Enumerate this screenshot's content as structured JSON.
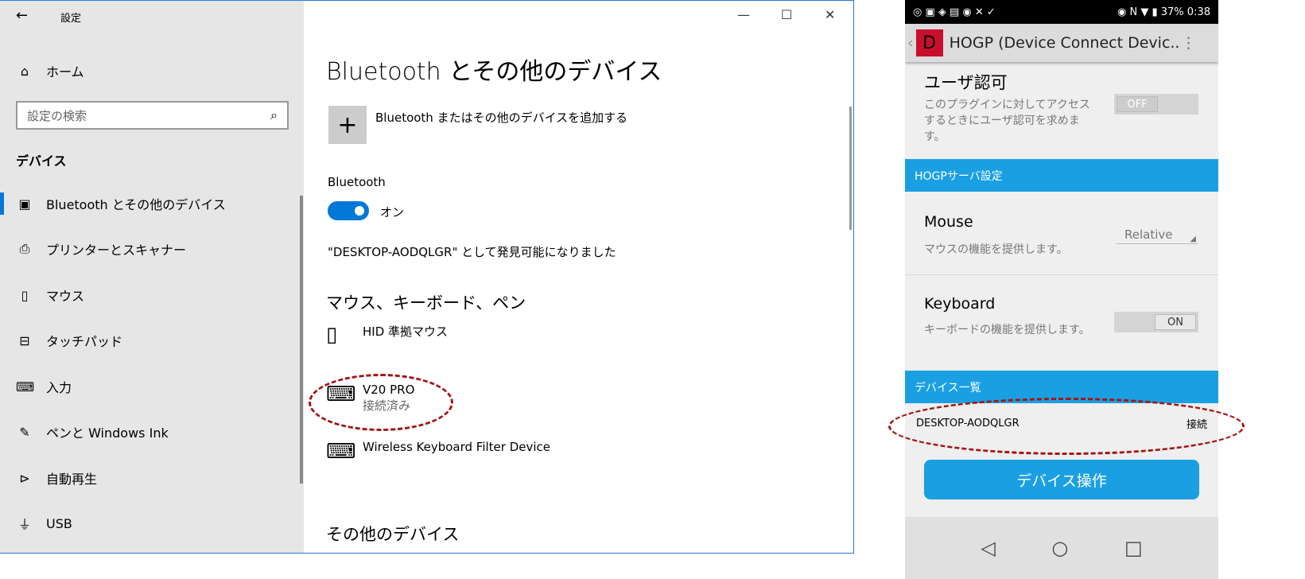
{
  "window": {
    "title": "設定",
    "back_icon": "←",
    "min": "—",
    "max": "☐",
    "close": "✕"
  },
  "sidebar": {
    "home": "ホーム",
    "search_placeholder": "設定の検索",
    "section": "デバイス",
    "items": [
      {
        "label": "Bluetooth とその他のデバイス",
        "icon": "bluetooth-devices"
      },
      {
        "label": "プリンターとスキャナー",
        "icon": "printer"
      },
      {
        "label": "マウス",
        "icon": "mouse"
      },
      {
        "label": "タッチパッド",
        "icon": "touchpad"
      },
      {
        "label": "入力",
        "icon": "keyboard"
      },
      {
        "label": "ペンと Windows Ink",
        "icon": "pen"
      },
      {
        "label": "自動再生",
        "icon": "autoplay"
      },
      {
        "label": "USB",
        "icon": "usb"
      }
    ]
  },
  "main": {
    "title": "Bluetooth とその他のデバイス",
    "add_label": "Bluetooth またはその他のデバイスを追加する",
    "bt_label": "Bluetooth",
    "bt_state": "オン",
    "discoverable": "\"DESKTOP-AODQLGR\" として発見可能になりました",
    "section1": "マウス、キーボード、ペン",
    "devices": [
      {
        "name": "HID 準拠マウス",
        "status": ""
      },
      {
        "name": "V20 PRO",
        "status": "接続済み"
      },
      {
        "name": "Wireless Keyboard Filter Device",
        "status": ""
      }
    ],
    "section2": "その他のデバイス"
  },
  "phone": {
    "battery": "37%",
    "time": "0:38",
    "app_title": "HOGP (Device Connect Devic..",
    "auth_title": "ユーザ認可",
    "auth_desc": "このプラグインに対してアクセスするときにユーザ認可を求めます。",
    "off": "OFF",
    "server_header": "HOGPサーバ設定",
    "mouse_title": "Mouse",
    "mouse_desc": "マウスの機能を提供します。",
    "mouse_mode": "Relative",
    "kb_title": "Keyboard",
    "kb_desc": "キーボードの機能を提供します。",
    "on": "ON",
    "list_header": "デバイス一覧",
    "device_name": "DESKTOP-AODQLGR",
    "device_action": "接続",
    "op_button": "デバイス操作"
  },
  "colors": {
    "accent": "#0078d7",
    "phone_blue": "#1aa0e2",
    "annotation": "#a31515"
  }
}
